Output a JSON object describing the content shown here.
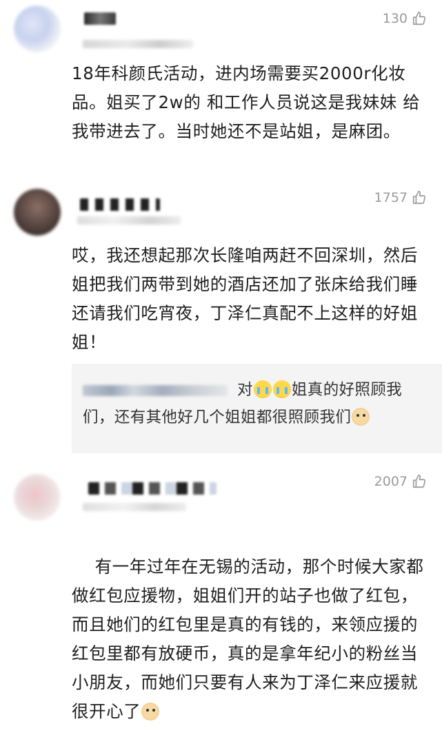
{
  "comments": [
    {
      "likes": "130",
      "text": "18年科颜氏活动，进内场需要买2000r化妆品。姐买了2w的 和工作人员说这是我妹妹 给我带进去了。当时她还不是站姐，是麻团。"
    },
    {
      "likes": "1757",
      "text": "哎，我还想起那次长隆咱两赶不回深圳，然后姐把我们两带到她的酒店还加了张床给我们睡还请我们吃宵夜，丁泽仁真配不上这样的好姐姐！",
      "reply": {
        "text_prefix": "对",
        "text": "姐真的好照顾我们，还有其他好几个姐姐都很照顾我们"
      }
    },
    {
      "likes": "2007",
      "text": "有一年过年在无锡的活动，那个时候大家都做红包应援物，姐姐们开的站子也做了红包，而且她们的红包里是真的有钱的，来领应援的红包里都有放硬币，真的是拿年纪小的粉丝当小朋友，而她们只要有人来为丁泽仁来应援就很开心了"
    }
  ],
  "icons": {
    "like": "thumbs-up-icon",
    "cry_emoji": "crying-face-emoji",
    "dog_emoji": "dog-face-emoji"
  },
  "colors": {
    "like_gray": "#9a9a9a",
    "reply_bg": "#f4f4f4"
  }
}
